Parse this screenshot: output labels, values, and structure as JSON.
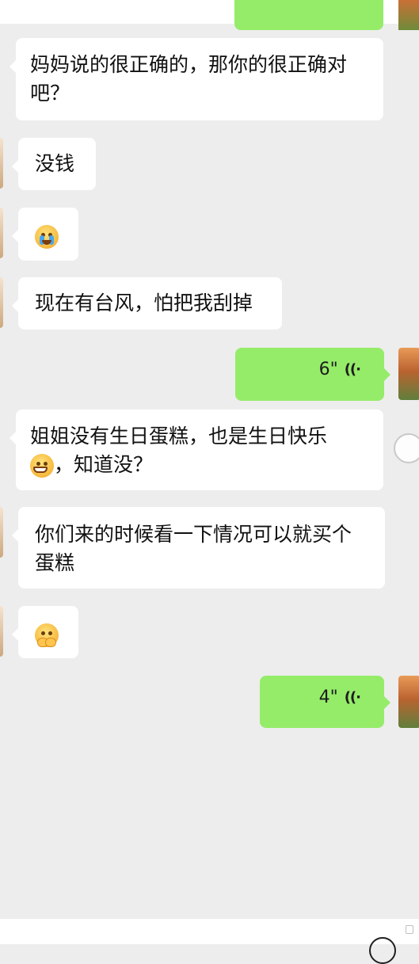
{
  "messages": [
    {
      "side": "left",
      "text": "妈妈说的很正确的，那你的很正确对吧？"
    },
    {
      "side": "left",
      "text": "没钱"
    },
    {
      "side": "left",
      "emoji": "crying-emoji"
    },
    {
      "side": "left",
      "text": "现在有台风，怕把我刮掉"
    },
    {
      "side": "right",
      "voice_duration": "6\""
    },
    {
      "side": "left",
      "text_a": "姐姐没有生日蛋糕，也是生日快乐",
      "text_b": "，知道没？",
      "emoji": "grinning-emoji"
    },
    {
      "side": "left",
      "text": "你们来的时候看一下情况可以就买个蛋糕"
    },
    {
      "side": "left",
      "emoji": "shy-emoji"
    },
    {
      "side": "right",
      "voice_duration": "4\""
    }
  ],
  "icons": {
    "voice": "voice-wave-icon",
    "selection": "selection-circle-icon"
  },
  "colors": {
    "background": "#ededed",
    "incoming_bubble": "#ffffff",
    "outgoing_bubble": "#95ec69"
  }
}
